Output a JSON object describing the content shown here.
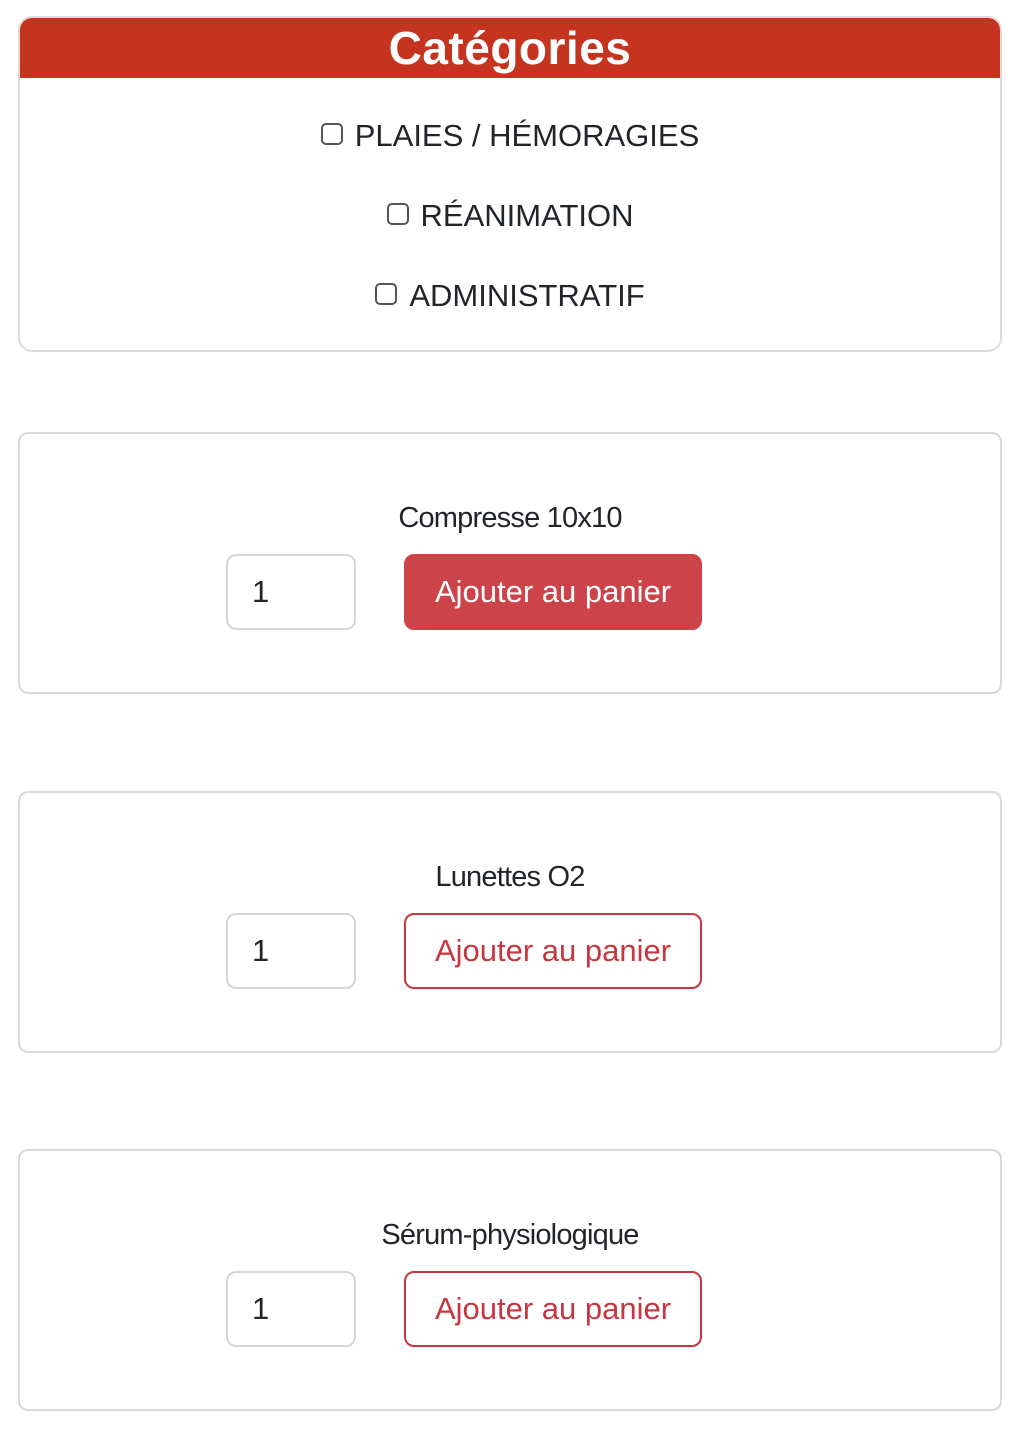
{
  "categories": {
    "title": "Catégories",
    "items": [
      {
        "label": "PLAIES / HÉMORAGIES",
        "checked": false
      },
      {
        "label": "RÉANIMATION",
        "checked": false
      },
      {
        "label": "ADMINISTRATIF",
        "checked": false
      }
    ]
  },
  "products": [
    {
      "name": "Compresse 10x10",
      "quantity": "1",
      "button_label": "Ajouter au panier",
      "button_style": "filled"
    },
    {
      "name": "Lunettes O2",
      "quantity": "1",
      "button_label": "Ajouter au panier",
      "button_style": "outline"
    },
    {
      "name": "Sérum-physiologique",
      "quantity": "1",
      "button_label": "Ajouter au panier",
      "button_style": "outline"
    }
  ],
  "colors": {
    "header_bg": "#c4341e",
    "button_filled": "#cc434a",
    "button_outline": "#c8373f"
  }
}
